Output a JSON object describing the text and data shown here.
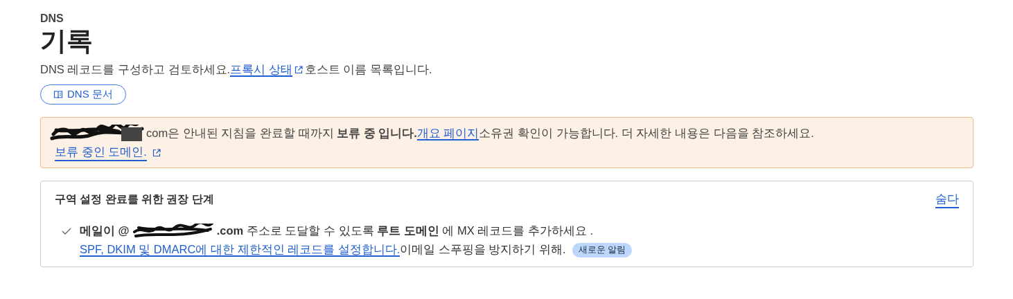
{
  "header": {
    "eyebrow": "DNS",
    "title": "기록"
  },
  "description": {
    "before": "DNS 레코드를 구성하고 검토하세요.",
    "link": "프록시 상태",
    "after": "호스트 이름 목록입니다."
  },
  "docs_button": {
    "label": "DNS 문서"
  },
  "notice": {
    "before": "com은 안내된 지침을 완료할 때까지 **보류 중 입니다.**",
    "link": "개요 페이지",
    "after": "소유권 확인이 가능합니다. 더 자세한 내용은 다음을 참조하세요.",
    "second_link": "보류 중인 도메인."
  },
  "steps_card": {
    "title": "구역 설정 완료를 위한 권장 단계",
    "hide_link": "숨다",
    "items": [
      {
        "done": true,
        "before": "메일이 @",
        "after": "**.com** 주소로 도달할 수 있도록 **루트 도메인** 에 MX 레코드를 추가하세요 .",
        "link": "SPF, DKIM 및 DMARC에 대한 제한적인 레코드를 설정합니다.",
        "tail": "이메일 스푸핑을 방지하기 위해.",
        "badge": "새로운 알림"
      }
    ]
  }
}
